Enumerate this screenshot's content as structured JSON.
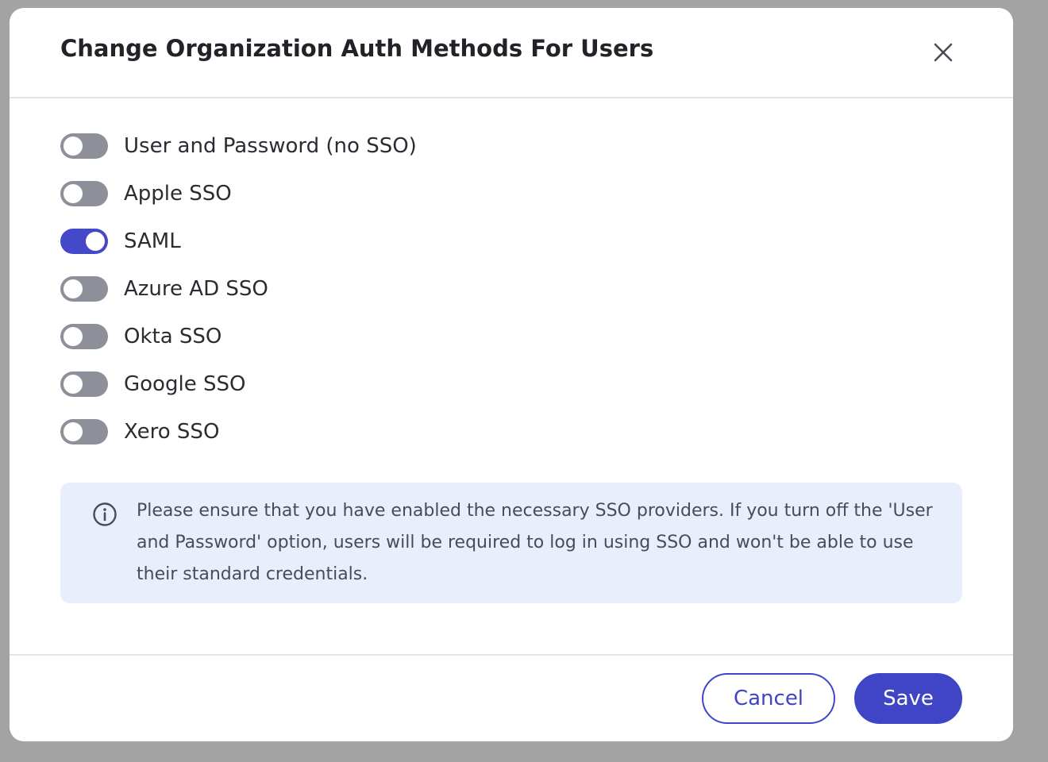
{
  "dialog": {
    "title": "Change Organization Auth Methods For Users",
    "close_icon": "close-icon"
  },
  "auth_methods": [
    {
      "label": "User and Password (no SSO)",
      "enabled": false
    },
    {
      "label": "Apple SSO",
      "enabled": false
    },
    {
      "label": "SAML",
      "enabled": true
    },
    {
      "label": "Azure AD SSO",
      "enabled": false
    },
    {
      "label": "Okta SSO",
      "enabled": false
    },
    {
      "label": "Google SSO",
      "enabled": false
    },
    {
      "label": "Xero SSO",
      "enabled": false
    }
  ],
  "info": {
    "icon": "info-icon",
    "text": "Please ensure that you have enabled the necessary SSO providers. If you turn off the 'User and Password' option, users will be required to log in using SSO and won't be able to use their standard credentials."
  },
  "footer": {
    "cancel_label": "Cancel",
    "save_label": "Save"
  },
  "colors": {
    "accent": "#3f45c4",
    "toggle_off": "#8d8f99",
    "info_bg": "#e9eefc",
    "overlay": "#a3a3a3"
  }
}
